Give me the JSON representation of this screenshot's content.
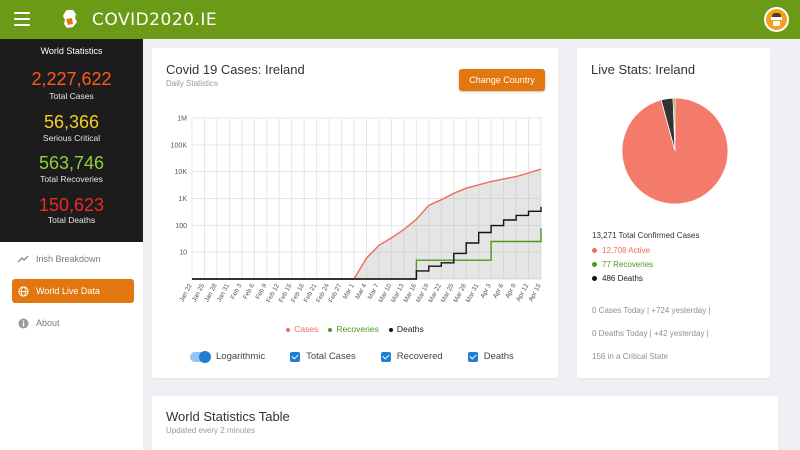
{
  "topbar": {
    "logo_text": "COVID2020.IE",
    "bg_color": "#6b9a16"
  },
  "sidebar": {
    "stats_title": "World Statistics",
    "stats": [
      {
        "value": "2,227,622",
        "label": "Total Cases",
        "color": "#ff5a1a"
      },
      {
        "value": "56,366",
        "label": "Serious Critical",
        "color": "#f2d023"
      },
      {
        "value": "563,746",
        "label": "Total Recoveries",
        "color": "#8fd13c"
      },
      {
        "value": "150,623",
        "label": "Total Deaths",
        "color": "#ee2a1f"
      }
    ],
    "nav": [
      {
        "label": "Irish Breakdown",
        "icon": "trend-icon"
      },
      {
        "label": "World Live Data",
        "icon": "globe-icon",
        "active": true
      },
      {
        "label": "About",
        "icon": "info-icon"
      }
    ]
  },
  "chart_card": {
    "title": "Covid 19 Cases: Ireland",
    "subtitle": "Daily Statistics",
    "button": "Change Country",
    "legend": [
      {
        "label": "Cases",
        "color": "#ef6c5a"
      },
      {
        "label": "Recoveries",
        "color": "#4a9a1c"
      },
      {
        "label": "Deaths",
        "color": "#111111"
      }
    ],
    "controls": {
      "log_label": "Logarithmic",
      "cases_label": "Total Cases",
      "recovered_label": "Recovered",
      "deaths_label": "Deaths"
    }
  },
  "chart_data": {
    "type": "line",
    "y_scale": "log",
    "ylim": [
      1,
      1000000
    ],
    "y_ticks": [
      "1M",
      "100K",
      "10K",
      "1K",
      "100",
      "10"
    ],
    "x": [
      "Jan 22",
      "Jan 25",
      "Jan 28",
      "Jan 31",
      "Feb 3",
      "Feb 6",
      "Feb 9",
      "Feb 12",
      "Feb 15",
      "Feb 18",
      "Feb 21",
      "Feb 24",
      "Feb 27",
      "Mar 1",
      "Mar 4",
      "Mar 7",
      "Mar 10",
      "Mar 13",
      "Mar 16",
      "Mar 19",
      "Mar 22",
      "Mar 25",
      "Mar 28",
      "Mar 31",
      "Apr 3",
      "Apr 6",
      "Apr 9",
      "Apr 12",
      "Apr 15"
    ],
    "grid": true,
    "series": [
      {
        "name": "Cases",
        "color": "#ef6c5a",
        "values": [
          0,
          0,
          0,
          0,
          0,
          0,
          0,
          0,
          0,
          0,
          0,
          0,
          0,
          1,
          6,
          18,
          34,
          70,
          169,
          557,
          906,
          1564,
          2415,
          3235,
          4273,
          5364,
          6574,
          8928,
          12547
        ]
      },
      {
        "name": "Recoveries",
        "color": "#4a9a1c",
        "values": [
          0,
          0,
          0,
          0,
          0,
          0,
          0,
          0,
          0,
          0,
          0,
          0,
          0,
          0,
          0,
          0,
          0,
          0,
          5,
          5,
          5,
          5,
          5,
          5,
          25,
          25,
          25,
          25,
          77
        ]
      },
      {
        "name": "Deaths",
        "color": "#111111",
        "values": [
          0,
          0,
          0,
          0,
          0,
          0,
          0,
          0,
          0,
          0,
          0,
          0,
          0,
          0,
          0,
          0,
          1,
          1,
          2,
          3,
          4,
          9,
          22,
          54,
          98,
          158,
          235,
          334,
          486
        ]
      }
    ]
  },
  "live_card": {
    "title": "Live Stats: Ireland",
    "pie": [
      {
        "label": "Active",
        "value": 12708,
        "color": "#f47b6b"
      },
      {
        "label": "Recoveries",
        "value": 77,
        "color": "#4a9a1c"
      },
      {
        "label": "Deaths",
        "value": 486,
        "color": "#333333"
      }
    ],
    "total_line": "13,271 Total Confirmed Cases",
    "active_line": "12,708 Active",
    "recoveries_line": "77 Recoveries",
    "deaths_line": "486 Deaths",
    "cases_today": "0 Cases Today | +724 yesterday |",
    "deaths_today": "0 Deaths Today | +42 yesterday |",
    "critical": "156 in a Critical State"
  },
  "table_card": {
    "title": "World Statistics Table",
    "subtitle": "Updated every 2 minutes"
  }
}
